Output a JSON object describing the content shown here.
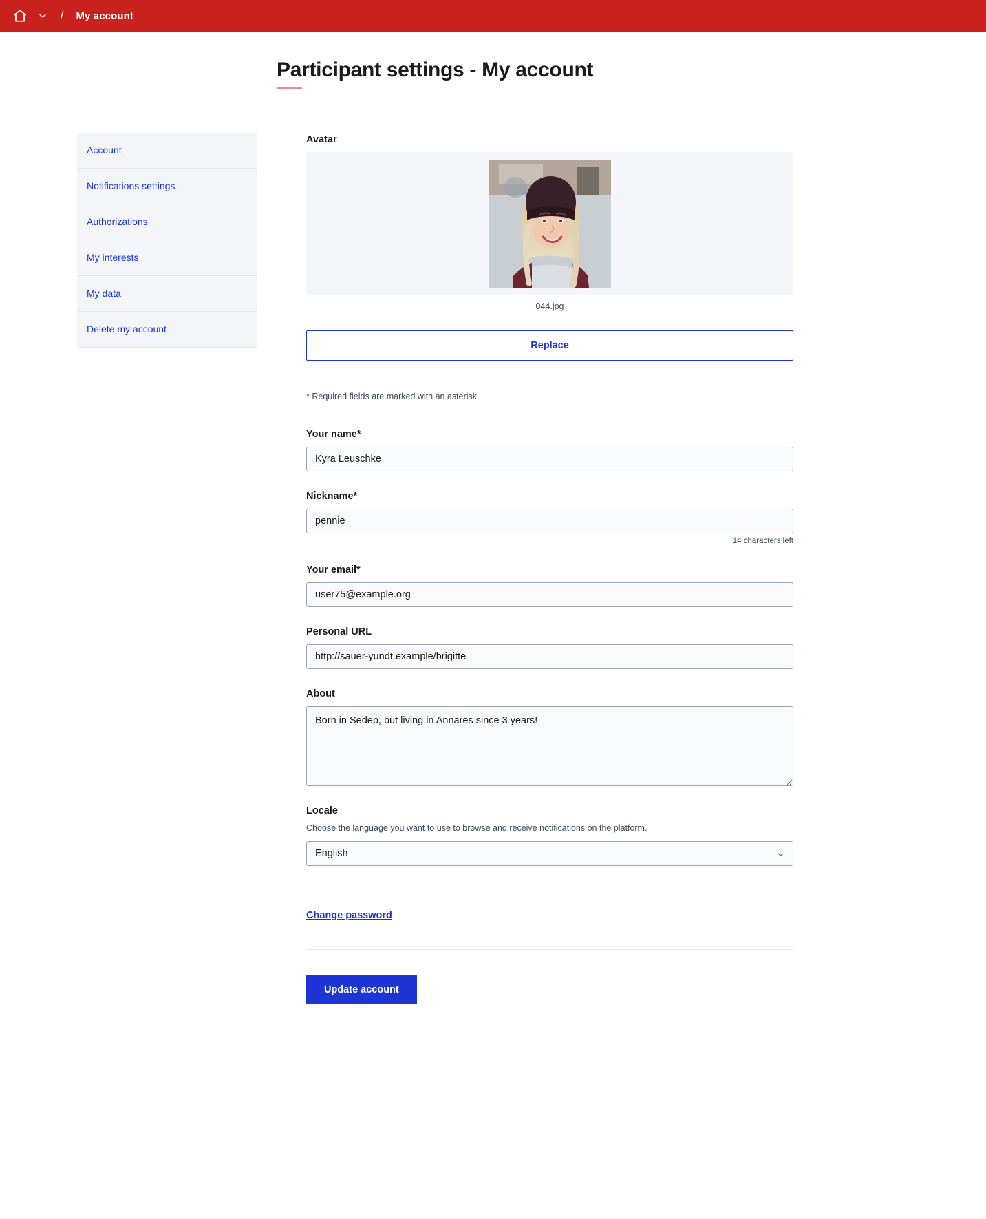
{
  "topbar": {
    "home_icon": "home-icon",
    "chevron_icon": "chevron-down-icon",
    "separator": "/",
    "current": "My account",
    "background_color": "#c9211e"
  },
  "page": {
    "title": "Participant settings - My account",
    "accent_color": "#ef8a97",
    "link_color": "#1d35d4"
  },
  "sidebar": {
    "items": [
      {
        "label": "Account"
      },
      {
        "label": "Notifications settings"
      },
      {
        "label": "Authorizations"
      },
      {
        "label": "My interests"
      },
      {
        "label": "My data"
      },
      {
        "label": "Delete my account"
      }
    ]
  },
  "form": {
    "avatar": {
      "label": "Avatar",
      "filename": "044.jpg",
      "replace_label": "Replace",
      "image_alt": "avatar-photo"
    },
    "required_note": "* Required fields are marked with an asterisk",
    "name": {
      "label": "Your name*",
      "value": "Kyra Leuschke"
    },
    "nickname": {
      "label": "Nickname*",
      "value": "pennie",
      "characters_left": "14 characters left"
    },
    "email": {
      "label": "Your email*",
      "value": "user75@example.org"
    },
    "personal_url": {
      "label": "Personal URL",
      "value": "http://sauer-yundt.example/brigitte"
    },
    "about": {
      "label": "About",
      "value": "Born in Sedep, but living in Annares since 3 years!"
    },
    "locale": {
      "label": "Locale",
      "help": "Choose the language you want to use to browse and receive notifications on the platform.",
      "selected": "English",
      "options": [
        "English"
      ]
    },
    "change_password_label": "Change password",
    "submit_label": "Update account"
  }
}
